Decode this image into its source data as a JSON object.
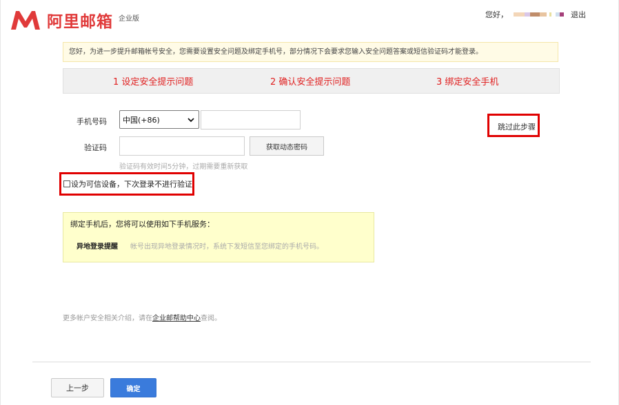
{
  "header": {
    "brand": "阿里邮箱",
    "edition": "企业版",
    "greeting": "您好，",
    "logout": "退出",
    "logo_color": "#e03a3a"
  },
  "notice": "您好，为进一步提升邮箱帐号安全，您需要设置安全问题及绑定手机号，部分情况下会要求您输入安全问题答案或短信验证码才能登录。",
  "steps": [
    {
      "label": "1 设定安全提示问题"
    },
    {
      "label": "2 确认安全提示问题"
    },
    {
      "label": "3 绑定安全手机"
    }
  ],
  "form": {
    "phone_label": "手机号码",
    "country_selected": "中国(+86)",
    "phone_value": "",
    "code_label": "验证码",
    "code_value": "",
    "get_code_button": "获取动态密码",
    "code_hint": "验证码有效时间5分钟，过期需要重新获取",
    "skip_link": "跳过此步骤",
    "trust_device": "设为可信设备，下次登录不进行验证",
    "trust_checked": false
  },
  "service": {
    "title": "绑定手机后，您将可以使用如下手机服务：",
    "items": [
      {
        "name": "异地登录提醒",
        "desc": "帐号出现异地登录情况时，系统下发短信至您绑定的手机号码。"
      }
    ]
  },
  "more_info": {
    "prefix": "更多帐户安全相关介绍，请在",
    "link": "企业邮帮助中心",
    "suffix": "查阅。"
  },
  "buttons": {
    "prev": "上一步",
    "confirm": "确定"
  },
  "colors": {
    "step_text": "#e02020",
    "highlight_box": "#e00000",
    "primary_button": "#3a7bdc"
  },
  "icons": [
    "mail-logo-icon",
    "chevron-down-icon",
    "checkbox-icon"
  ]
}
